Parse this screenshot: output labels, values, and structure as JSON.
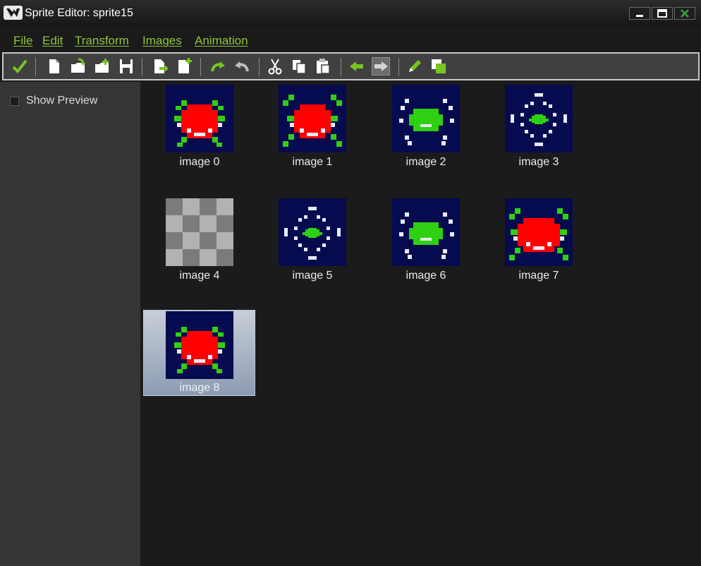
{
  "window": {
    "title": "Sprite Editor: sprite15",
    "icon": "gamemaker-logo-icon",
    "controls": [
      "minimize-icon",
      "maximize-icon",
      "close-icon"
    ]
  },
  "menu": [
    {
      "label": "File"
    },
    {
      "label": "Edit"
    },
    {
      "label": "Transform"
    },
    {
      "label": "Images"
    },
    {
      "label": "Animation"
    }
  ],
  "toolbar": {
    "buttons": [
      "confirm-icon",
      "new-icon",
      "open-icon",
      "add-from-file-icon",
      "save-icon",
      "add-empty-before-icon",
      "add-empty-after-icon",
      "undo-icon",
      "redo-icon",
      "cut-icon",
      "copy-icon",
      "paste-icon",
      "shift-left-icon",
      "shift-right-icon",
      "edit-image-icon",
      "resize-canvas-icon"
    ]
  },
  "sidebar": {
    "show_preview_label": "Show Preview",
    "show_preview_checked": false
  },
  "images": [
    {
      "label": "image 0",
      "type": "red-bug-a"
    },
    {
      "label": "image 1",
      "type": "red-bug-b"
    },
    {
      "label": "image 2",
      "type": "green-pulse-a"
    },
    {
      "label": "image 3",
      "type": "green-pulse-b"
    },
    {
      "label": "image 4",
      "type": "checker"
    },
    {
      "label": "image 5",
      "type": "green-pulse-b"
    },
    {
      "label": "image 6",
      "type": "green-pulse-a"
    },
    {
      "label": "image 7",
      "type": "red-bug-c"
    },
    {
      "label": "image 8",
      "type": "red-bug-a",
      "selected": true
    }
  ],
  "colors": {
    "menu_text": "#8fc53b",
    "sprite_bg": "#060a4e",
    "sprite_red": "#ff0000",
    "sprite_green": "#2ed012",
    "selection": "#a9b4c7"
  }
}
